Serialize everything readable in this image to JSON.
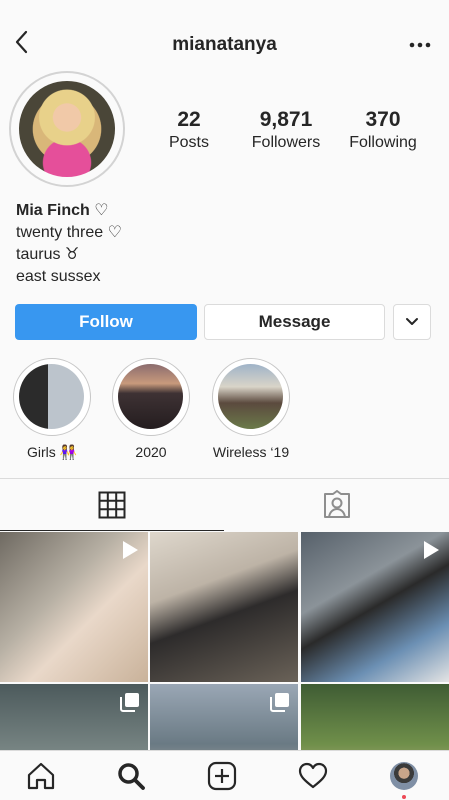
{
  "header": {
    "username": "mianatanya"
  },
  "stats": [
    {
      "value": "22",
      "label": "Posts"
    },
    {
      "value": "9,871",
      "label": "Followers"
    },
    {
      "value": "370",
      "label": "Following"
    }
  ],
  "bio": {
    "name": "Mia Finch ♡",
    "lines": [
      "twenty three ♡",
      "taurus ♉︎",
      "east sussex"
    ]
  },
  "actions": {
    "follow": "Follow",
    "message": "Message"
  },
  "highlights": [
    {
      "label": "Girls 👭"
    },
    {
      "label": "2020"
    },
    {
      "label": "Wireless ‘19"
    }
  ],
  "colors": {
    "accent": "#3897f0",
    "text": "#262626",
    "border": "#dbdbdb",
    "notification": "#ed4956"
  },
  "icons": {
    "back": "chevron-left-icon",
    "more": "more-horizontal-icon",
    "dropdown": "chevron-down-icon",
    "grid": "grid-icon",
    "tagged": "tagged-person-icon",
    "video": "video-play-icon",
    "carousel": "multiple-images-icon",
    "home": "home-icon",
    "search": "search-icon",
    "add": "add-post-icon",
    "activity": "heart-icon",
    "profile": "profile-avatar"
  }
}
